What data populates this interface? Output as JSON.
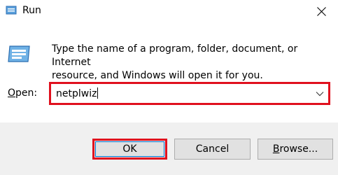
{
  "window": {
    "title": "Run",
    "icon": "run-icon",
    "close_icon": "close-icon"
  },
  "description": {
    "line1": "Type the name of a program, folder, document, or Internet",
    "line2": "resource, and Windows will open it for you."
  },
  "open": {
    "label_underlined": "O",
    "label_rest": "pen:",
    "value": "netplwiz"
  },
  "buttons": {
    "ok": "OK",
    "cancel": "Cancel",
    "browse_underlined": "B",
    "browse_rest": "rowse..."
  },
  "colors": {
    "highlight": "#e0101e",
    "focus": "#0078d7",
    "footer_bg": "#f0f0f0"
  }
}
